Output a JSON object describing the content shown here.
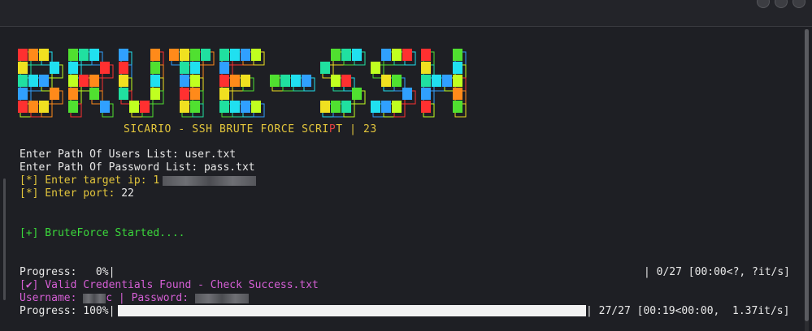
{
  "window": {
    "controls": [
      "minimize",
      "maximize",
      "close"
    ]
  },
  "banner": {
    "logo_text": "BRUTE-SSH",
    "subtitle_parts": [
      "SICARIO - SSH BRUTE FORCE SCRI",
      "P",
      "T | 23"
    ]
  },
  "prompts": {
    "users_label": "Enter Path Of Users List: ",
    "users_value": "user.txt",
    "passwords_label": "Enter Path Of Password List: ",
    "passwords_value": "pass.txt",
    "target_ip_label": "[*] Enter target ip: 1",
    "port_label": "[*] Enter port: ",
    "port_value": "22"
  },
  "status": {
    "started": "[+] BruteForce Started...."
  },
  "progress1": {
    "label": "Progress:   0%|",
    "right": "| 0/27 [00:00<?, ?it/s]",
    "fraction": 0
  },
  "result": {
    "found": "[✔] Valid Credentials Found - Check Success.txt",
    "username_label": "Username: ",
    "username_tail": "c",
    "password_label": " | Password: "
  },
  "progress2": {
    "label": "Progress: 100%|",
    "right": "| 27/27 [00:19<00:00,  1.37it/s]",
    "fraction": 1.0
  },
  "colors": {
    "background": "#1e1f24",
    "yellow": "#e3c63c",
    "green": "#3bd93b",
    "magenta": "#d55fd5"
  }
}
